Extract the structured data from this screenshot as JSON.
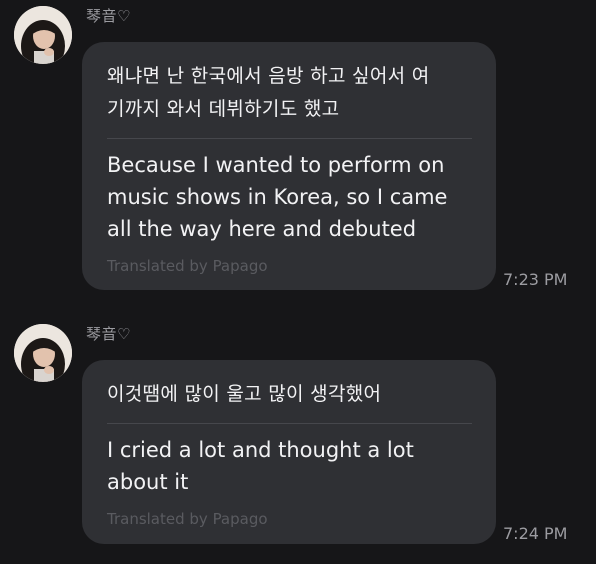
{
  "messages": [
    {
      "sender": "琴音♡",
      "original": "왜냐면 난 한국에서 음방 하고 싶어서 여\n기까지 와서 데뷔하기도 했고",
      "translation": "Because I wanted to perform on music shows in Korea, so I came all the way here and debuted",
      "credit": "Translated by Papago",
      "time": "7:23 PM"
    },
    {
      "sender": "琴音♡",
      "original": "이것땜에 많이 울고 많이 생각했어",
      "translation": "I cried a lot and thought a lot about it",
      "credit": "Translated by Papago",
      "time": "7:24 PM"
    }
  ],
  "colors": {
    "background": "#161618",
    "bubble": "#2f3034",
    "text": "#f2f2f4",
    "muted": "#9c9ca1",
    "credit": "#5a5b60"
  }
}
